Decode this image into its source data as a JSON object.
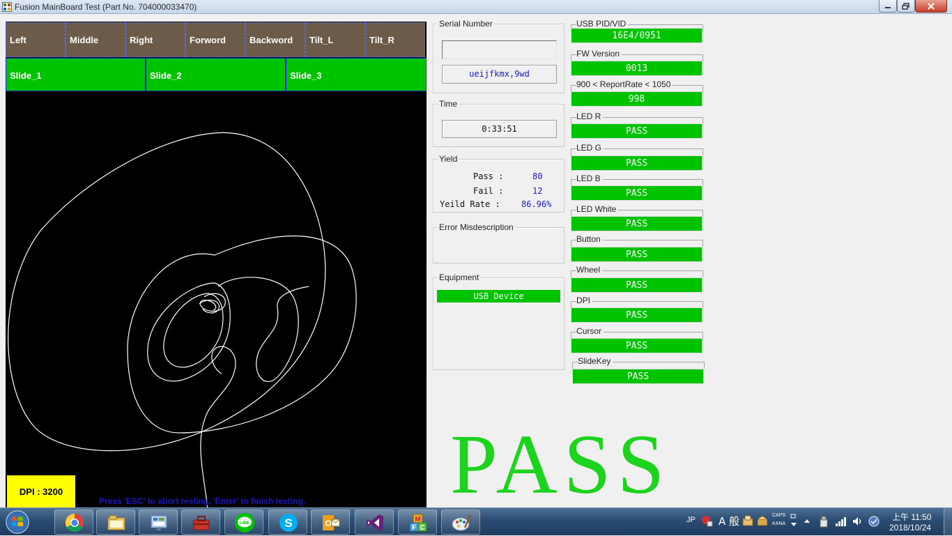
{
  "window": {
    "title": "Fusion MainBoard Test (Part No. 704000033470)"
  },
  "buttons": [
    "Left",
    "Middle",
    "Right",
    "Forword",
    "Backword",
    "Tilt_L",
    "Tilt_R"
  ],
  "slides": [
    "Slide_1",
    "Slide_2",
    "Slide_3"
  ],
  "dpi_label": "DPI : 3200",
  "hint": "Press 'ESC' to abort testing, 'Enter' to finish testing.",
  "serial": {
    "legend": "Serial Number",
    "input_value": "",
    "value": "ueijfkmx,9wd"
  },
  "time": {
    "legend": "Time",
    "value": "0:33:51"
  },
  "yield": {
    "legend": "Yield",
    "pass_label": "Pass :",
    "pass_value": "80",
    "fail_label": "Fail :",
    "fail_value": "12",
    "rate_label": "Yeild Rate :",
    "rate_value": "86.96%"
  },
  "error": {
    "legend": "Error Misdescription",
    "value": ""
  },
  "equipment": {
    "legend": "Equipment",
    "value": "USB Device"
  },
  "fields": [
    {
      "label": "USB PID/VID",
      "value": "16E4/0951"
    },
    {
      "label": "FW Version",
      "value": "0013"
    },
    {
      "label": "900 < ReportRate < 1050",
      "value": "998"
    },
    {
      "label": "LED R",
      "value": "PASS"
    },
    {
      "label": "LED G",
      "value": "PASS"
    },
    {
      "label": "LED B",
      "value": "PASS"
    },
    {
      "label": "LED White",
      "value": "PASS"
    },
    {
      "label": "Button",
      "value": "PASS"
    },
    {
      "label": "Wheel",
      "value": "PASS"
    },
    {
      "label": "DPI",
      "value": "PASS"
    },
    {
      "label": "Cursor",
      "value": "PASS"
    },
    {
      "label": "SlideKey",
      "value": "PASS"
    }
  ],
  "result": "PASS",
  "taskbar": {
    "apps": [
      "chrome-icon",
      "file-explorer-icon",
      "control-panel-icon",
      "toolbox-icon",
      "line-icon",
      "skype-icon",
      "outlook-icon",
      "visual-studio-icon",
      "mfc-icon",
      "paint-icon"
    ],
    "tray": {
      "lang": "JP",
      "ime": "A 般",
      "caps": "CAPS",
      "kana": "KANA"
    },
    "time": "上午 11:50",
    "date": "2018/10/24"
  },
  "colors": {
    "pass_green": "#00c300",
    "button_brown": "#6b5b48",
    "dpi_yellow": "#ffff00",
    "result_green": "#1ed31e",
    "hint_blue": "#1a16c8"
  }
}
